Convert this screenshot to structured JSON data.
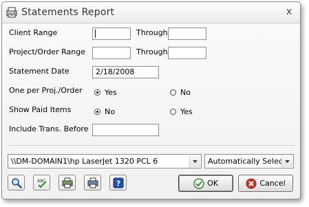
{
  "window": {
    "title": "Statements Report",
    "close_glyph": "x"
  },
  "form": {
    "client_range": {
      "label": "Client Range",
      "through_label": "Through",
      "from_value": "",
      "to_value": ""
    },
    "project_order_range": {
      "label": "Project/Order Range",
      "through_label": "Through",
      "from_value": "",
      "to_value": ""
    },
    "statement_date": {
      "label": "Statement Date",
      "value": "2/18/2008"
    },
    "one_per_proj": {
      "label": "One per Proj./Order",
      "options": [
        "Yes",
        "No"
      ],
      "selected": "Yes"
    },
    "show_paid_items": {
      "label": "Show Paid Items",
      "options": [
        "No",
        "Yes"
      ],
      "selected": "No"
    },
    "include_trans_before": {
      "label": "Include Trans. Before",
      "value": ""
    }
  },
  "printer": {
    "name": "\\\\DM-DOMAIN1\\hp LaserJet 1320 PCL 6",
    "tray": "Automatically Select"
  },
  "toolbar": {
    "icons": [
      "preview-icon",
      "spellcheck-icon",
      "print-setup-icon",
      "print-icon",
      "help-icon"
    ],
    "ok_label": "OK",
    "cancel_label": "Cancel"
  },
  "colors": {
    "ok_check": "#2e8b2e",
    "cancel_x": "#c0392b",
    "help_blue": "#1f4fa8"
  }
}
